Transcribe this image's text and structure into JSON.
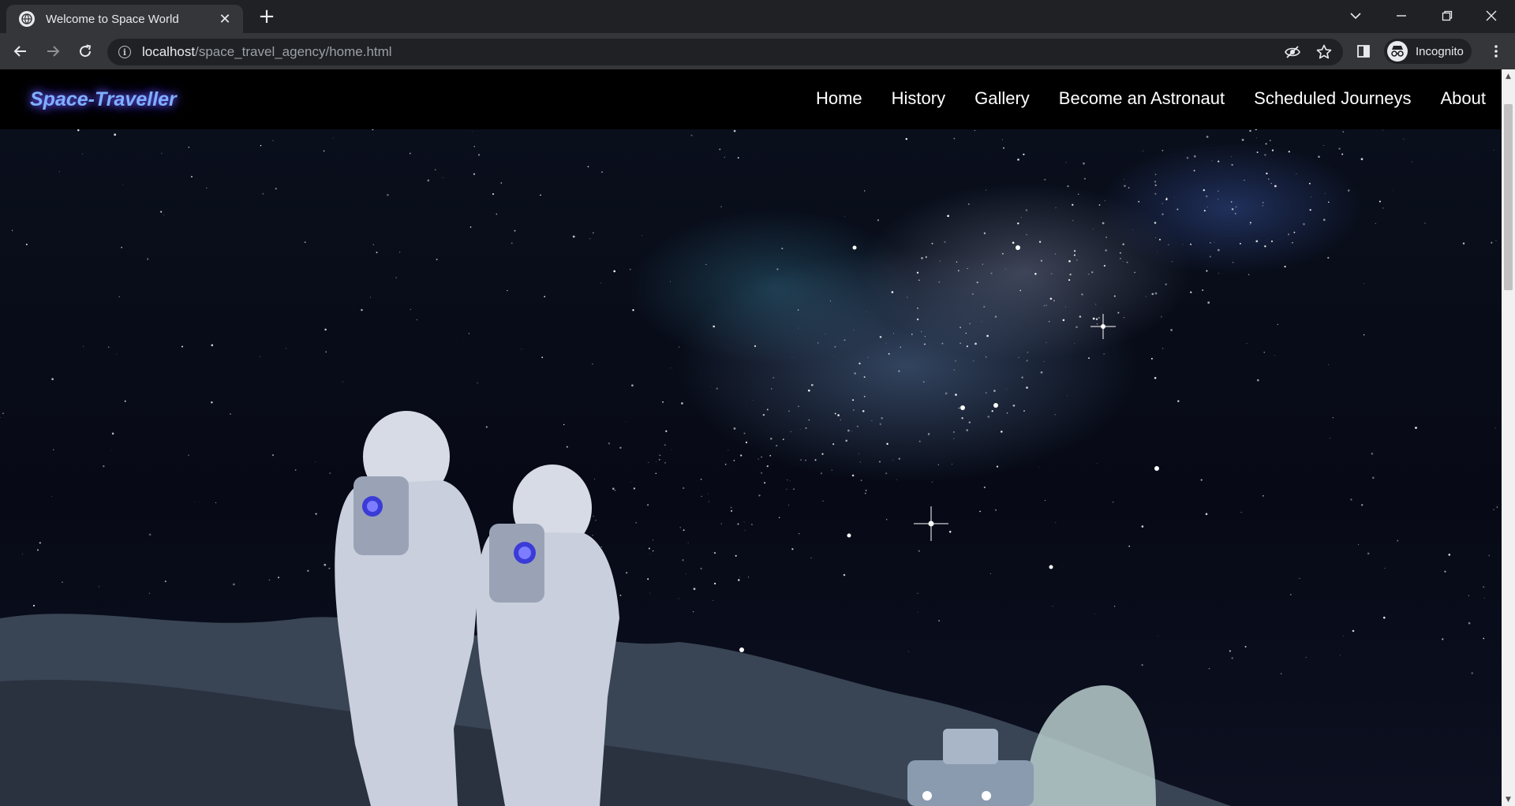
{
  "browser": {
    "tab": {
      "title": "Welcome to Space World",
      "favicon": "globe-icon",
      "close_label": "✕"
    },
    "new_tab_label": "+",
    "url_host": "localhost",
    "url_path": "/space_travel_agency/home.html",
    "profile_label": "Incognito"
  },
  "site": {
    "brand": "Space-Traveller",
    "nav": [
      {
        "label": "Home"
      },
      {
        "label": "History"
      },
      {
        "label": "Gallery"
      },
      {
        "label": "Become an Astronaut"
      },
      {
        "label": "Scheduled Journeys"
      },
      {
        "label": "About"
      }
    ]
  },
  "colors": {
    "brand_text": "#7fb0ff",
    "brand_glow": "#6a5cff",
    "nav_background": "#000000",
    "chrome_dark": "#202124",
    "chrome_light": "#35363a"
  }
}
